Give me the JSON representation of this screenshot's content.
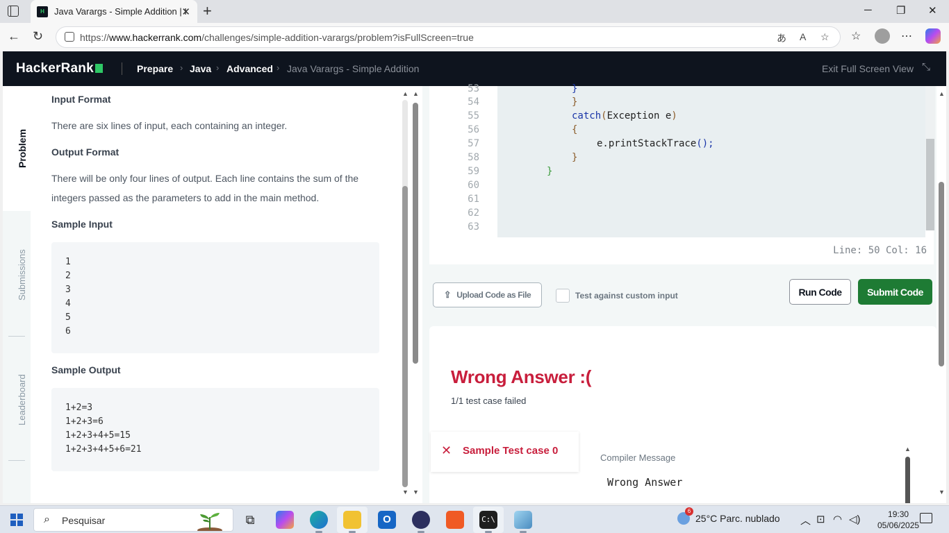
{
  "browser": {
    "tab_title": "Java Varargs - Simple Addition | H",
    "url_prefix": "https://",
    "url_host": "www.hackerrank.com",
    "url_path": "/challenges/simple-addition-varargs/problem?isFullScreen=true",
    "favicon_text": "H"
  },
  "header": {
    "logo": "HackerRank",
    "breadcrumbs": [
      "Prepare",
      "Java",
      "Advanced",
      "Java Varargs - Simple Addition"
    ],
    "exit_label": "Exit Full Screen View"
  },
  "sidenav": {
    "tabs": [
      "Problem",
      "Submissions",
      "Leaderboard"
    ]
  },
  "problem": {
    "input_format_title": "Input Format",
    "input_format_text": "There are six lines of input, each containing an integer.",
    "output_format_title": "Output Format",
    "output_format_text": "There will be only four lines of output. Each line contains the sum of the integers passed as the parameters to add in the main method.",
    "sample_input_title": "Sample Input",
    "sample_input": [
      "1",
      "2",
      "3",
      "4",
      "5",
      "6"
    ],
    "sample_output_title": "Sample Output",
    "sample_output": [
      "1+2=3",
      "1+2+3=6",
      "1+2+3+4+5=15",
      "1+2+3+4+5+6=21"
    ]
  },
  "editor": {
    "line_numbers": [
      "53",
      "54",
      "55",
      "56",
      "57",
      "58",
      "59",
      "60",
      "61",
      "62",
      "63"
    ],
    "code_lines": {
      "l53": "}",
      "l54": "}",
      "l55_kw": "catch",
      "l55_rest": "Exception e",
      "l56": "{",
      "l57_a": "e.printStackTrace",
      "l57_b": "();",
      "l58": "}",
      "l59": "}"
    },
    "status": "Line: 50 Col: 16"
  },
  "actions": {
    "upload_label": "Upload Code as File",
    "custom_input_label": "Test against custom input",
    "run_label": "Run Code",
    "submit_label": "Submit Code"
  },
  "result": {
    "headline": "Wrong Answer :(",
    "summary": "1/1 test case failed",
    "test_case_label": "Sample Test case 0",
    "compiler_message_title": "Compiler Message",
    "compiler_message": "Wrong Answer"
  },
  "taskbar": {
    "search_placeholder": "Pesquisar",
    "weather_badge": "6",
    "weather": "25°C  Parc. nublado",
    "time": "19:30",
    "date": "05/06/2025"
  },
  "colors": {
    "brand_dark": "#0e141e",
    "brand_green": "#2ec866",
    "submit_green": "#1e7b34",
    "error_red": "#c81e3c"
  }
}
